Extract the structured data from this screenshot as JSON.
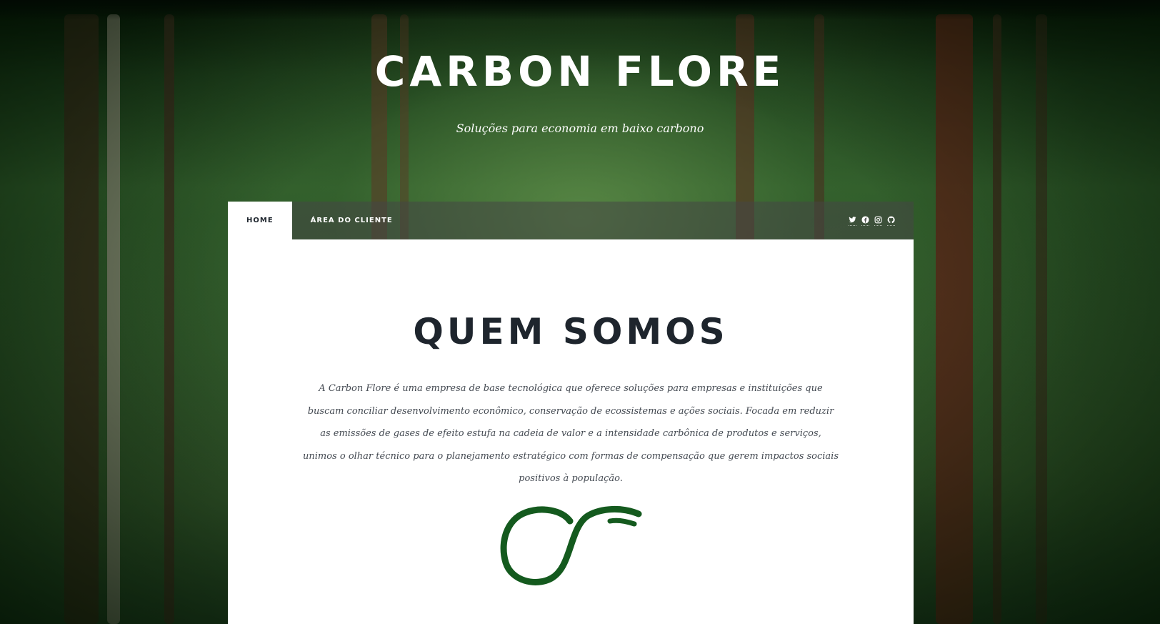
{
  "header": {
    "title": "CARBON FLORE",
    "tagline": "Soluções para economia em baixo carbono"
  },
  "nav": {
    "items": [
      {
        "label": "HOME",
        "active": true
      },
      {
        "label": "ÁREA DO CLIENTE",
        "active": false
      }
    ],
    "social_icons": [
      "twitter-icon",
      "facebook-icon",
      "instagram-icon",
      "github-icon"
    ]
  },
  "main": {
    "section_title": "QUEM SOMOS",
    "about_text": "A Carbon Flore é uma empresa de base tecnológica que oferece soluções para empresas e instituições que buscam conciliar desenvolvimento econômico, conservação de ecossistemas e ações sociais. Focada em reduzir as emissões de gases de efeito estufa na cadeia de valor e a intensidade carbônica de produtos e serviços, unimos o olhar técnico para o planejamento estratégico com formas de compensação que gerem impactos sociais positivos à população."
  },
  "colors": {
    "logo_green": "#145a1e",
    "heading_dark": "#1e252d",
    "body_text": "#444a52"
  }
}
